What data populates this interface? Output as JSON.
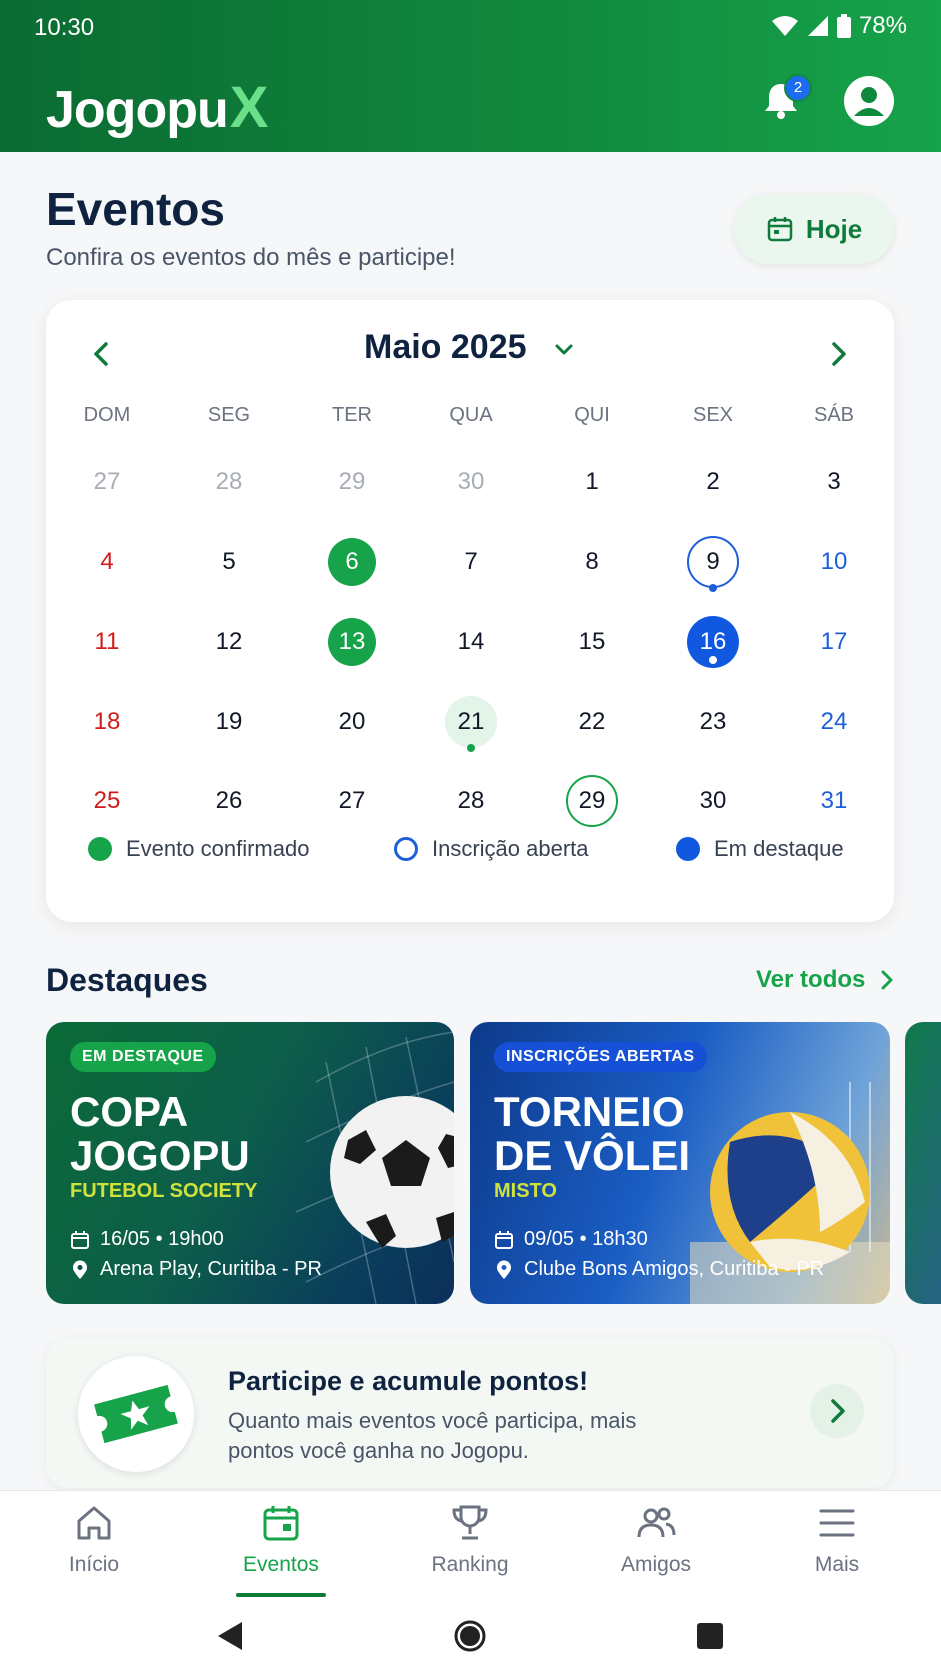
{
  "status_bar": {
    "time": "10:30",
    "battery": "78%"
  },
  "header": {
    "logo_text": "Jogopu",
    "logo_accent": "X",
    "notification_count": "2"
  },
  "page": {
    "title": "Eventos",
    "subtitle": "Confira os eventos do mês e participe!",
    "today_label": "Hoje"
  },
  "calendar": {
    "month_label": "Maio 2025",
    "weekdays": [
      "DOM",
      "SEG",
      "TER",
      "QUA",
      "QUI",
      "SEX",
      "SÁB"
    ],
    "weeks": [
      [
        "27",
        "28",
        "29",
        "30",
        "1",
        "2",
        "3"
      ],
      [
        "4",
        "5",
        "6",
        "7",
        "8",
        "9",
        "10"
      ],
      [
        "11",
        "12",
        "13",
        "14",
        "15",
        "16",
        "17"
      ],
      [
        "18",
        "19",
        "20",
        "21",
        "22",
        "23",
        "24"
      ],
      [
        "25",
        "26",
        "27",
        "28",
        "29",
        "30",
        "31"
      ]
    ],
    "legend": {
      "confirmed": "Evento confirmado",
      "open": "Inscrição aberta",
      "featured": "Em destaque"
    }
  },
  "highlights": {
    "title": "Destaques",
    "see_all": "Ver todos",
    "events": [
      {
        "badge": "EM DESTAQUE",
        "title_line1": "COPA",
        "title_line2": "JOGOPU",
        "subtitle": "FUTEBOL SOCIETY",
        "datetime": "16/05 • 19h00",
        "location": "Arena Play, Curitiba - PR"
      },
      {
        "badge": "INSCRIÇÕES ABERTAS",
        "title_line1": "TORNEIO",
        "title_line2": "DE VÔLEI",
        "subtitle": "MISTO",
        "datetime": "09/05 • 18h30",
        "location": "Clube Bons Amigos, Curitiba - PR"
      }
    ]
  },
  "promo": {
    "title": "Participe e acumule pontos!",
    "text": "Quanto mais eventos você participa, mais pontos você ganha no Jogopu."
  },
  "tabs": [
    "Início",
    "Eventos",
    "Ranking",
    "Amigos",
    "Mais"
  ],
  "colors": {
    "brand_green": "#16a34a",
    "dark_green": "#0f7a3a",
    "featured_blue": "#1058e0",
    "sunday_red": "#d21b1b",
    "saturday_blue": "#1d5fd8"
  },
  "icons": [
    "bell-icon",
    "user-avatar-icon",
    "calendar-icon",
    "chevron-left-icon",
    "chevron-right-icon",
    "chevron-down-icon",
    "location-pin-icon",
    "ticket-star-icon",
    "home-icon",
    "trophy-icon",
    "people-icon",
    "menu-icon"
  ]
}
